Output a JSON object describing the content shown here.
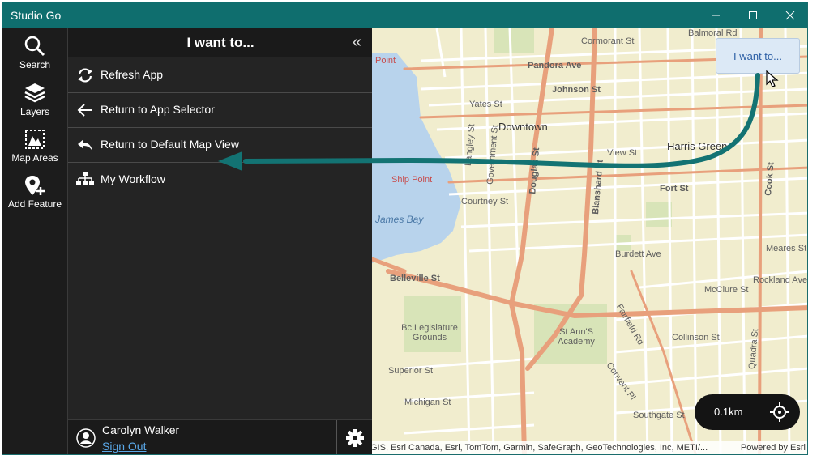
{
  "window": {
    "title": "Studio Go"
  },
  "rail": {
    "items": [
      {
        "label": "Search",
        "icon": "search-icon"
      },
      {
        "label": "Layers",
        "icon": "layers-icon"
      },
      {
        "label": "Map Areas",
        "icon": "map-areas-icon"
      },
      {
        "label": "Add Feature",
        "icon": "add-feature-icon"
      }
    ]
  },
  "panel": {
    "title": "I want to...",
    "collapse_glyph": "«",
    "items": [
      {
        "label": "Refresh App",
        "icon": "refresh-icon"
      },
      {
        "label": "Return to App Selector",
        "icon": "arrow-left-icon"
      },
      {
        "label": "Return to Default Map View",
        "icon": "undo-icon"
      },
      {
        "label": "My Workflow",
        "icon": "workflow-icon"
      }
    ],
    "user": {
      "name": "Carolyn Walker",
      "sign_out": "Sign Out"
    }
  },
  "map": {
    "labels": [
      "Cormorant St",
      "Balmoral Rd",
      "Pandora Ave",
      "Johnson St",
      "Yates St",
      "Downtown",
      "Harris Green",
      "View St",
      "Fort St",
      "Courtney St",
      "Ship Point",
      "James Bay",
      "Burdett Ave",
      "Meares St",
      "McClure St",
      "Rockland Ave",
      "Belleville St",
      "Bc Legislature Grounds",
      "St Ann'S Academy",
      "Collinson St",
      "Superior St",
      "Michigan St",
      "Southgate St",
      "Fairfield Rd",
      "Convent Pl",
      "Douglas St",
      "Blanshard St",
      "Cook St",
      "Government St",
      "Langley St",
      "Quadra St",
      "Point"
    ],
    "iwant_button": "I want to...",
    "scale": "0.1km",
    "attribution": "GIS, Esri Canada, Esri, TomTom, Garmin, SafeGraph, GeoTechnologies, Inc, METI/...",
    "powered_by": "Powered by Esri"
  },
  "colors": {
    "titlebar": "#0f6e6e",
    "arrow": "#137373",
    "map_bg": "#f1edce",
    "arterial": "#e8a07c"
  }
}
